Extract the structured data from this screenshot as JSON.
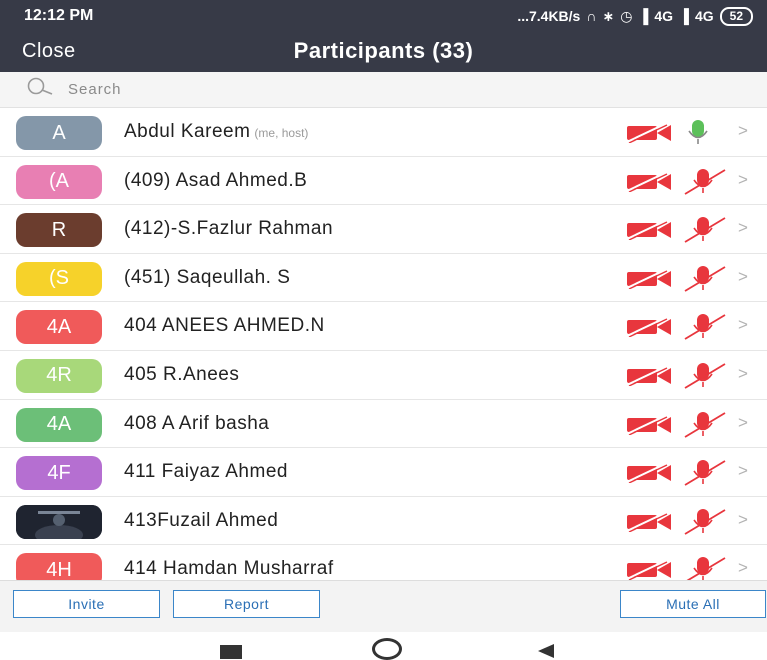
{
  "status_bar": {
    "time": "12:12 PM",
    "network_text": "...7.4KB/s",
    "signal_text": "4G",
    "battery": "52",
    "icons": [
      "headphones-icon",
      "bluetooth-icon",
      "alarm-icon",
      "signal-icon",
      "signal-icon"
    ]
  },
  "header": {
    "close_label": "Close",
    "title": "Participants (33)"
  },
  "search": {
    "placeholder": "Search",
    "icon": "search-icon"
  },
  "colors": {
    "header_bg": "#373a47",
    "muted_red": "#e8363d",
    "mic_on_green": "#5cc05a",
    "button_blue": "#3b86c9"
  },
  "participants": [
    {
      "initials": "A",
      "avatar_color": "#8497a9",
      "name": "Abdul Kareem",
      "tag": "(me, host)",
      "video": "off",
      "mic": "on"
    },
    {
      "initials": "(A",
      "avatar_color": "#e87fb3",
      "name": "(409) Asad Ahmed.B",
      "tag": "",
      "video": "off",
      "mic": "off"
    },
    {
      "initials": "R",
      "avatar_color": "#6b3d2e",
      "name": "(412)-S.Fazlur Rahman",
      "tag": "",
      "video": "off",
      "mic": "off"
    },
    {
      "initials": "(S",
      "avatar_color": "#f6d22a",
      "name": "(451) Saqeullah. S",
      "tag": "",
      "video": "off",
      "mic": "off"
    },
    {
      "initials": "4A",
      "avatar_color": "#f05a5a",
      "name": "404 ANEES AHMED.N",
      "tag": "",
      "video": "off",
      "mic": "off"
    },
    {
      "initials": "4R",
      "avatar_color": "#a8d87a",
      "name": "405 R.Anees",
      "tag": "",
      "video": "off",
      "mic": "off"
    },
    {
      "initials": "4A",
      "avatar_color": "#6cbf78",
      "name": "408 A Arif basha",
      "tag": "",
      "video": "off",
      "mic": "off"
    },
    {
      "initials": "4F",
      "avatar_color": "#b56fd1",
      "name": "411 Faiyaz Ahmed",
      "tag": "",
      "video": "off",
      "mic": "off"
    },
    {
      "initials": "",
      "avatar_color": "#1f2430",
      "name": "413Fuzail Ahmed",
      "tag": "",
      "video": "off",
      "mic": "off",
      "photo": true
    },
    {
      "initials": "4H",
      "avatar_color": "#f05a5a",
      "name": "414 Hamdan Musharraf",
      "tag": "",
      "video": "off",
      "mic": "off"
    }
  ],
  "bottom_bar": {
    "invite_label": "Invite",
    "report_label": "Report",
    "mute_all_label": "Mute All"
  }
}
